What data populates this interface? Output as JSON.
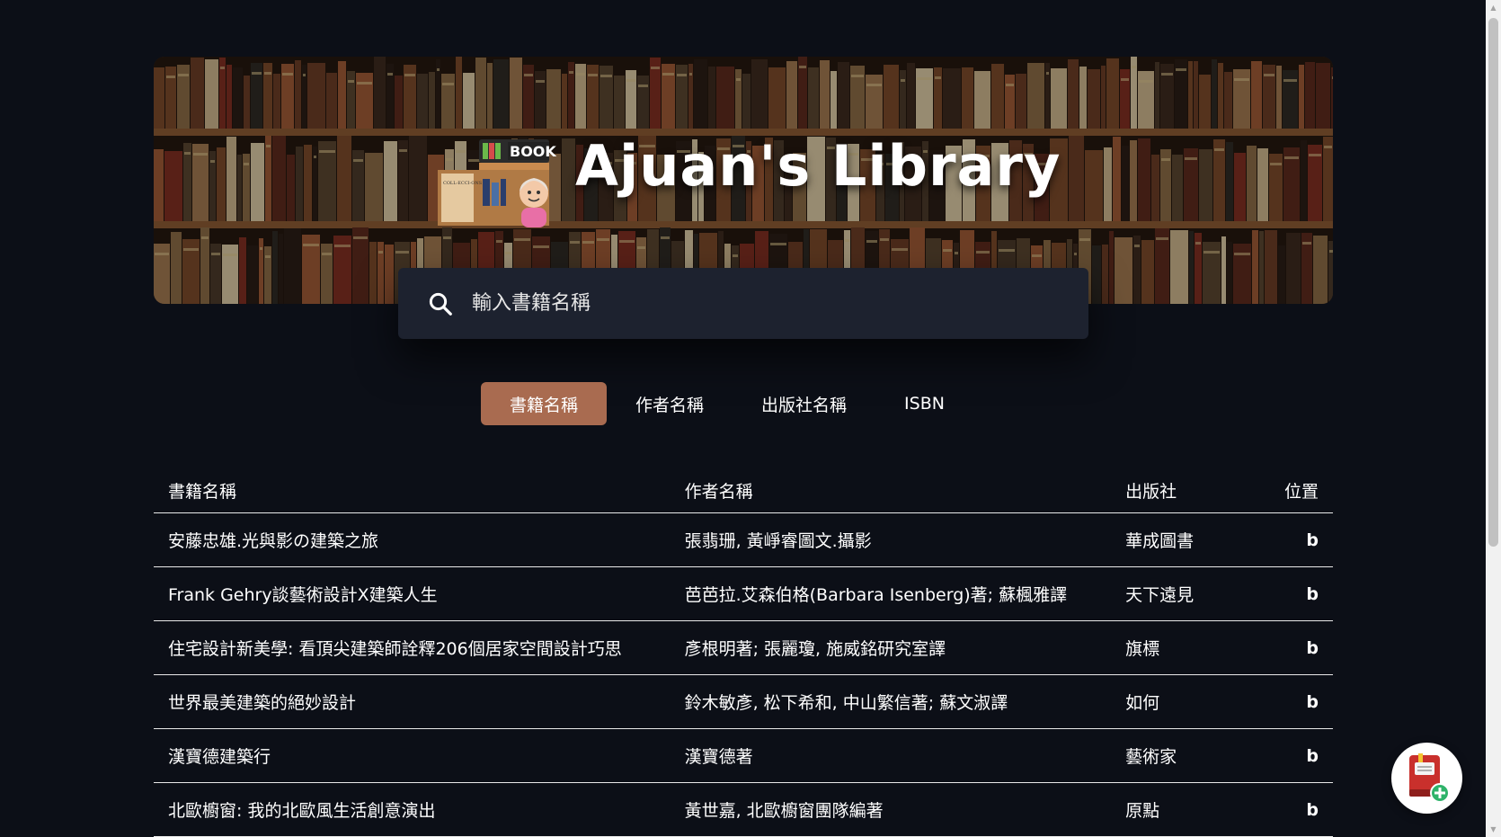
{
  "header": {
    "title": "Ajuan's Library",
    "logo_text": "BOOK",
    "logo_sign": "COLL-ECCI-ONS"
  },
  "search": {
    "placeholder": "輸入書籍名稱",
    "icon": "search-icon"
  },
  "tabs": [
    {
      "label": "書籍名稱",
      "active": true
    },
    {
      "label": "作者名稱",
      "active": false
    },
    {
      "label": "出版社名稱",
      "active": false
    },
    {
      "label": "ISBN",
      "active": false
    }
  ],
  "table": {
    "headers": {
      "title": "書籍名稱",
      "author": "作者名稱",
      "publisher": "出版社",
      "location": "位置"
    },
    "rows": [
      {
        "title": "安藤忠雄.光與影の建築之旅",
        "author": "張翡珊, 黃崢睿圖文.攝影",
        "publisher": "華成圖書",
        "location": "b"
      },
      {
        "title": "Frank Gehry談藝術設計X建築人生",
        "author": "芭芭拉.艾森伯格(Barbara Isenberg)著; 蘇楓雅譯",
        "publisher": "天下遠見",
        "location": "b"
      },
      {
        "title": "住宅設計新美學: 看頂尖建築師詮釋206個居家空間設計巧思",
        "author": "彥根明著; 張麗瓊, 施威銘研究室譯",
        "publisher": "旗標",
        "location": "b"
      },
      {
        "title": "世界最美建築的絕妙設計",
        "author": "鈴木敏彥, 松下希和, 中山繁信著; 蘇文淑譯",
        "publisher": "如何",
        "location": "b"
      },
      {
        "title": "漢寶德建築行",
        "author": "漢寶德著",
        "publisher": "藝術家",
        "location": "b"
      },
      {
        "title": "北歐櫥窗: 我的北歐風生活創意演出",
        "author": "黃世嘉, 北歐櫥窗團隊編著",
        "publisher": "原點",
        "location": "b"
      }
    ]
  },
  "fab": {
    "icon": "add-book-icon"
  },
  "colors": {
    "background": "#0c0f17",
    "search_bg": "#1d222f",
    "active_tab": "#a96b50",
    "text": "#ffffff"
  }
}
